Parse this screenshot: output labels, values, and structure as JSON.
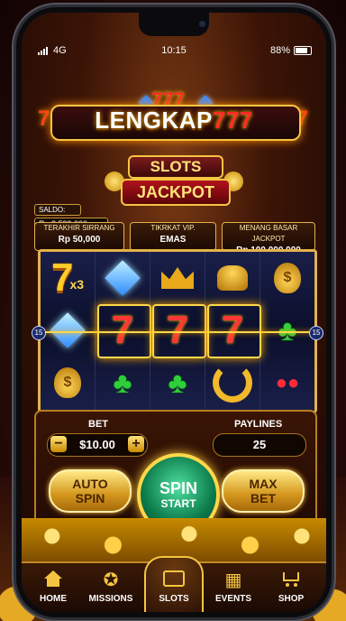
{
  "status_bar": {
    "carrier": "4G",
    "time": "10:15",
    "battery": "88%"
  },
  "logo": {
    "top_sevens": "777",
    "text_main": "LENGKAP",
    "text_sevens": "777",
    "left_seven": "7",
    "right_seven": "7"
  },
  "sign": {
    "line1": "SLOTS",
    "line2": "JACKPOT"
  },
  "saldo": {
    "label": "SALDO:",
    "value": "Rp 2.599,000"
  },
  "info_panels": [
    {
      "label": "TERAKHIR SIRRANG",
      "value": "Rp 50,000"
    },
    {
      "label": "TIKRKAT VIP.",
      "value": "EMAS"
    },
    {
      "label": "MENANG BASAR JACKPOT",
      "value": "Rp 100,000,000"
    }
  ],
  "reels": {
    "payline_number": "15",
    "symbols": [
      [
        "7",
        "diamond",
        "money-bag"
      ],
      [
        "diamond",
        "7",
        "clover"
      ],
      [
        "crown",
        "7",
        "clover"
      ],
      [
        "pot-of-gold",
        "7",
        "horseshoe"
      ],
      [
        "money-bag",
        "clover",
        "cherries"
      ]
    ],
    "multiplier": "x3",
    "bag_glyph": "$"
  },
  "controls": {
    "bet_label": "BET",
    "bet_value": "$10.00",
    "minus": "−",
    "plus": "+",
    "paylines_label": "PAYLINES",
    "paylines_value": "25",
    "auto_spin": [
      "AUTO",
      "SPIN"
    ],
    "spin": [
      "SPIN",
      "START"
    ],
    "max_bet": [
      "MAX",
      "BET"
    ]
  },
  "nav": [
    {
      "label": "HOME",
      "icon": "home-icon"
    },
    {
      "label": "MISSIONS",
      "icon": "missions-icon"
    },
    {
      "label": "SLOTS",
      "icon": "slots-icon"
    },
    {
      "label": "EVENTS",
      "icon": "events-icon"
    },
    {
      "label": "SHOP",
      "icon": "shop-icon"
    }
  ],
  "active_nav": "SLOTS",
  "colors": {
    "gold": "#f5c542",
    "accent_red": "#ff2a2a",
    "spin_green": "#0c7a4a",
    "reel_bg": "#0d1130"
  }
}
